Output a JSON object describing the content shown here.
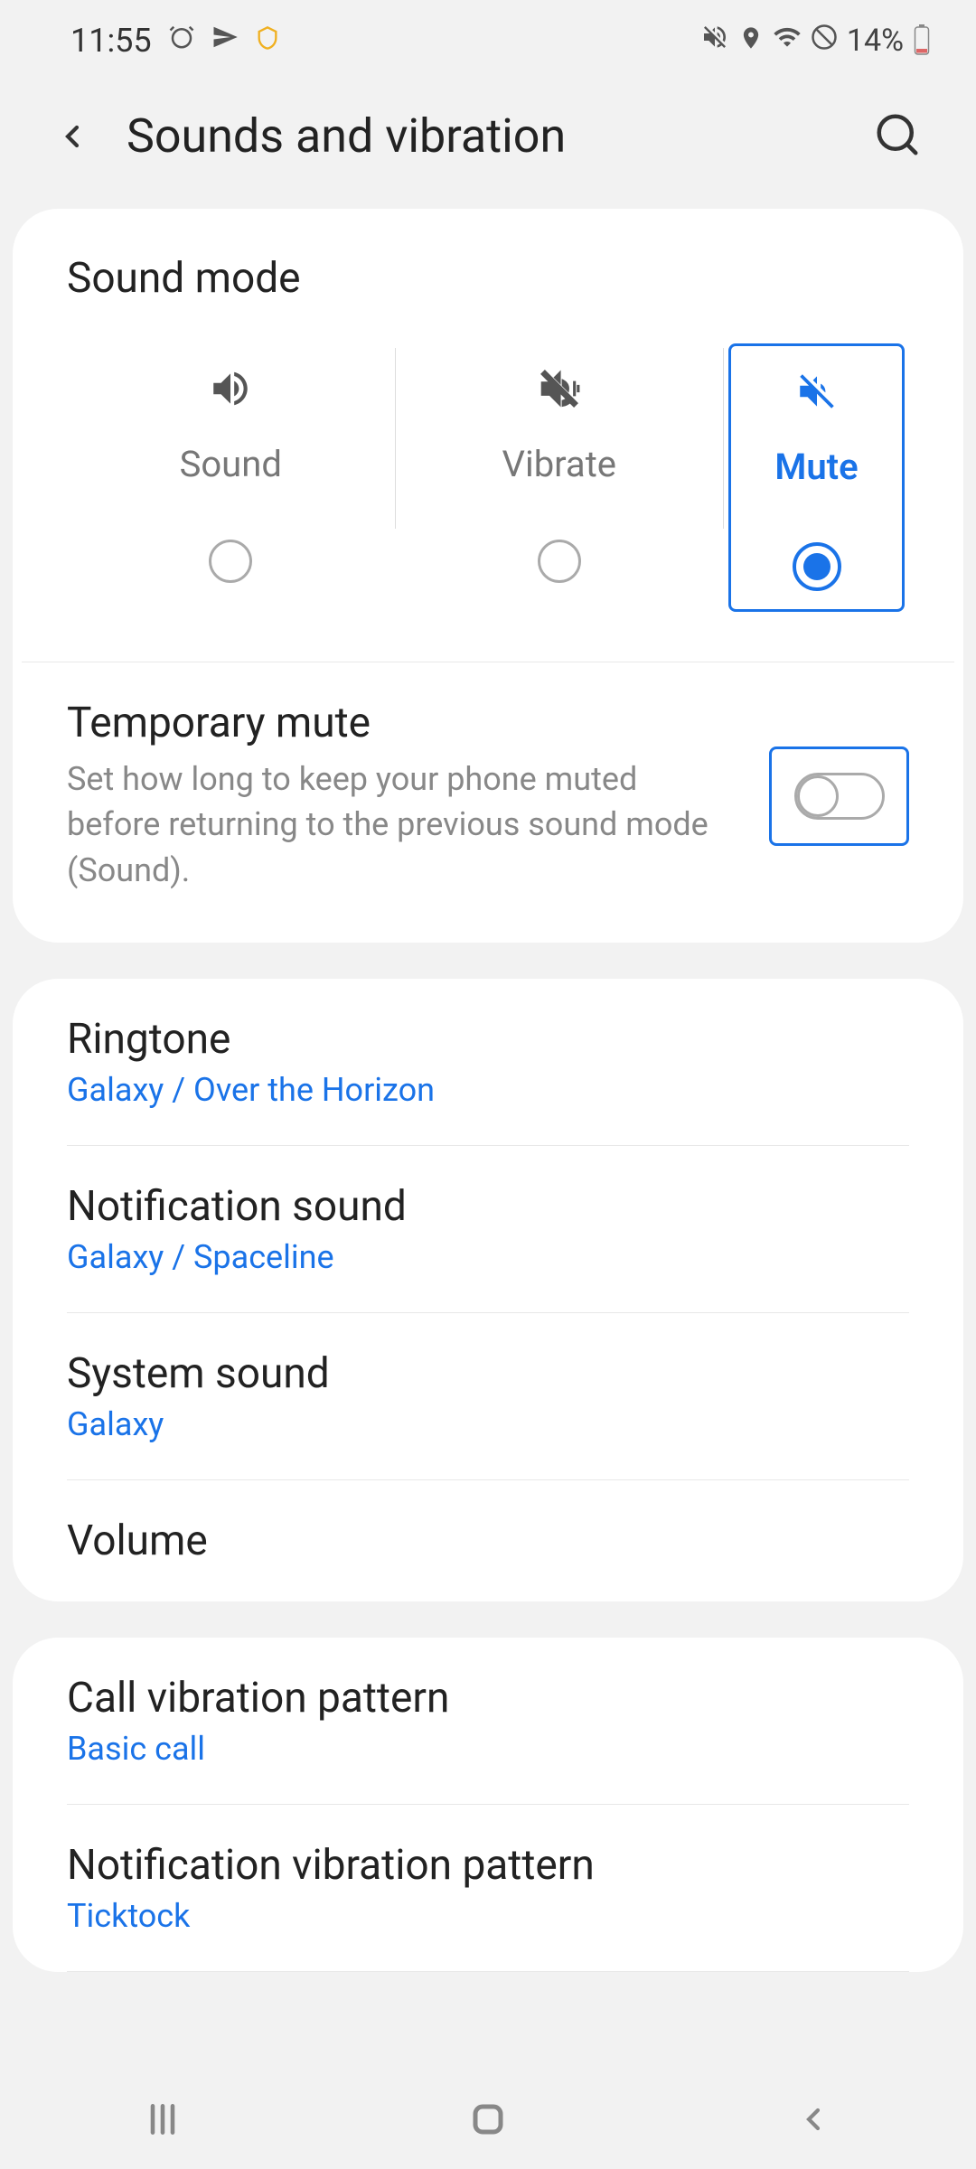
{
  "status": {
    "time": "11:55",
    "battery": "14%"
  },
  "header": {
    "title": "Sounds and vibration"
  },
  "sound_mode": {
    "label": "Sound mode",
    "options": {
      "sound": "Sound",
      "vibrate": "Vibrate",
      "mute": "Mute"
    },
    "selected": "mute"
  },
  "temp_mute": {
    "title": "Temporary mute",
    "desc": "Set how long to keep your phone muted before returning to the previous sound mode (Sound).",
    "enabled": false
  },
  "items": [
    {
      "title": "Ringtone",
      "sub": "Galaxy / Over the Horizon"
    },
    {
      "title": "Notification sound",
      "sub": "Galaxy / Spaceline"
    },
    {
      "title": "System sound",
      "sub": "Galaxy"
    },
    {
      "title": "Volume",
      "sub": null
    }
  ],
  "vibration_items": [
    {
      "title": "Call vibration pattern",
      "sub": "Basic call"
    },
    {
      "title": "Notification vibration pattern",
      "sub": "Ticktock"
    }
  ]
}
